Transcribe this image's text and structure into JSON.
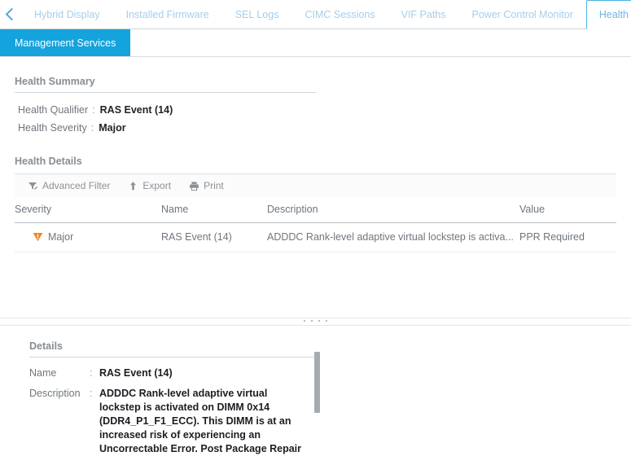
{
  "nav": {
    "scroll_left_icon": "chevron-left-icon",
    "tabs": [
      {
        "label": "Hybrid Display",
        "active": false
      },
      {
        "label": "Installed Firmware",
        "active": false
      },
      {
        "label": "SEL Logs",
        "active": false
      },
      {
        "label": "CIMC Sessions",
        "active": false
      },
      {
        "label": "VIF Paths",
        "active": false
      },
      {
        "label": "Power Control Monitor",
        "active": false
      },
      {
        "label": "Health",
        "active": true
      }
    ],
    "subtabs": [
      {
        "label": "Management Services",
        "active": true
      }
    ]
  },
  "health_summary": {
    "title": "Health Summary",
    "rows": [
      {
        "label": "Health Qualifier",
        "value": "RAS Event (14)"
      },
      {
        "label": "Health Severity",
        "value": "Major"
      }
    ]
  },
  "health_details": {
    "title": "Health Details",
    "toolbar": [
      {
        "label": "Advanced Filter",
        "icon": "filter-icon"
      },
      {
        "label": "Export",
        "icon": "export-up-arrow-icon"
      },
      {
        "label": "Print",
        "icon": "printer-icon"
      }
    ],
    "columns": [
      "Severity",
      "Name",
      "Description",
      "Value"
    ],
    "rows": [
      {
        "severity": "Major",
        "severity_icon": "major-warning-triangle-icon",
        "severity_color": "#f58220",
        "name": "RAS Event (14)",
        "description": "ADDDC Rank-level adaptive virtual lockstep is activa...",
        "value": "PPR Required"
      }
    ]
  },
  "details_panel": {
    "title": "Details",
    "fields": [
      {
        "label": "Name",
        "value": "RAS Event (14)"
      },
      {
        "label": "Description",
        "value": "ADDDC Rank-level adaptive virtual lockstep is activated on DIMM 0x14 (DDR4_P1_F1_ECC). This DIMM is at an increased risk of experiencing an Uncorrectable Error. Post Package Repair"
      }
    ]
  },
  "colors": {
    "accent_blue": "#14a3dc",
    "active_tab_border": "#4cb3e4",
    "inactive_tab_text": "#a8cde8",
    "severity_orange": "#f58220"
  }
}
